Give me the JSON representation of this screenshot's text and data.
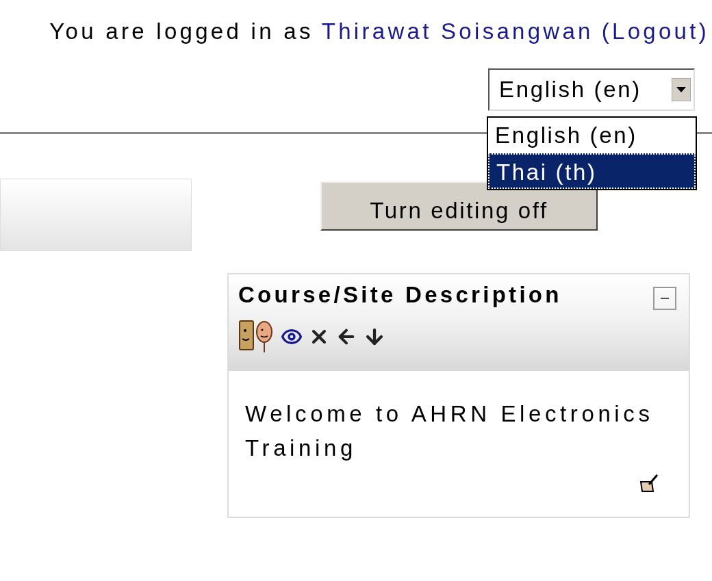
{
  "header": {
    "login_prefix": "You are logged in as",
    "user_name": "Thirawat Soisangwan",
    "logout": "(Logout)"
  },
  "language_select": {
    "value": "English (en)",
    "expanded": true,
    "options": [
      {
        "label": "English (en)",
        "highlighted": false
      },
      {
        "label": "Thai (th)",
        "highlighted": true
      }
    ]
  },
  "edit_button": "Turn editing off",
  "block": {
    "title": "Course/Site Description",
    "collapsed": false,
    "text": "Welcome to AHRN Electronics Training"
  }
}
